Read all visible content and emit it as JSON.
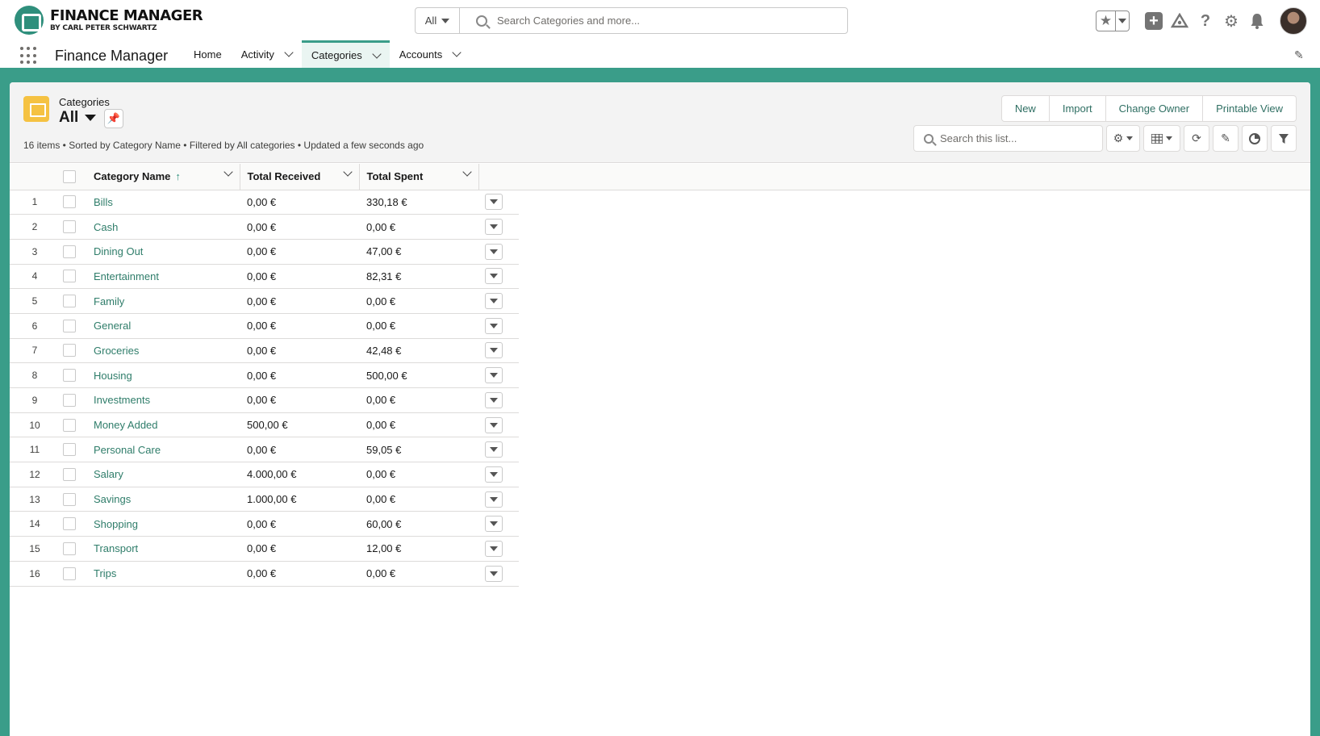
{
  "brand": {
    "title": "FINANCE MANAGER",
    "subtitle": "BY CARL PETER SCHWARTZ",
    "accent": "#3a9d89"
  },
  "search": {
    "scope": "All",
    "placeholder": "Search Categories and more..."
  },
  "header_icons": [
    "star-icon",
    "add-icon",
    "trailhead-icon",
    "help-icon",
    "setup-gear-icon",
    "bell-icon",
    "user-avatar"
  ],
  "nav": {
    "app_name": "Finance Manager",
    "items": [
      {
        "label": "Home",
        "has_menu": false,
        "active": false
      },
      {
        "label": "Activity",
        "has_menu": true,
        "active": false
      },
      {
        "label": "Categories",
        "has_menu": true,
        "active": true
      },
      {
        "label": "Accounts",
        "has_menu": true,
        "active": false
      }
    ]
  },
  "list_view": {
    "object_label": "Categories",
    "view_name": "All",
    "info": "16 items • Sorted by Category Name • Filtered by All categories • Updated a few seconds ago",
    "buttons": [
      "New",
      "Import",
      "Change Owner",
      "Printable View"
    ],
    "search_placeholder": "Search this list...",
    "tools": [
      "settings-gear-icon",
      "table-view-icon",
      "refresh-icon",
      "edit-pencil-icon",
      "chart-icon",
      "filter-icon"
    ]
  },
  "table": {
    "columns": [
      "Category Name",
      "Total Received",
      "Total Spent"
    ],
    "rows": [
      {
        "n": "1",
        "name": "Bills",
        "received": "0,00 €",
        "spent": "330,18 €"
      },
      {
        "n": "2",
        "name": "Cash",
        "received": "0,00 €",
        "spent": "0,00 €"
      },
      {
        "n": "3",
        "name": "Dining Out",
        "received": "0,00 €",
        "spent": "47,00 €"
      },
      {
        "n": "4",
        "name": "Entertainment",
        "received": "0,00 €",
        "spent": "82,31 €"
      },
      {
        "n": "5",
        "name": "Family",
        "received": "0,00 €",
        "spent": "0,00 €"
      },
      {
        "n": "6",
        "name": "General",
        "received": "0,00 €",
        "spent": "0,00 €"
      },
      {
        "n": "7",
        "name": "Groceries",
        "received": "0,00 €",
        "spent": "42,48 €"
      },
      {
        "n": "8",
        "name": "Housing",
        "received": "0,00 €",
        "spent": "500,00 €"
      },
      {
        "n": "9",
        "name": "Investments",
        "received": "0,00 €",
        "spent": "0,00 €"
      },
      {
        "n": "10",
        "name": "Money Added",
        "received": "500,00 €",
        "spent": "0,00 €"
      },
      {
        "n": "11",
        "name": "Personal Care",
        "received": "0,00 €",
        "spent": "59,05 €"
      },
      {
        "n": "12",
        "name": "Salary",
        "received": "4.000,00 €",
        "spent": "0,00 €"
      },
      {
        "n": "13",
        "name": "Savings",
        "received": "1.000,00 €",
        "spent": "0,00 €"
      },
      {
        "n": "14",
        "name": "Shopping",
        "received": "0,00 €",
        "spent": "60,00 €"
      },
      {
        "n": "15",
        "name": "Transport",
        "received": "0,00 €",
        "spent": "12,00 €"
      },
      {
        "n": "16",
        "name": "Trips",
        "received": "0,00 €",
        "spent": "0,00 €"
      }
    ]
  }
}
